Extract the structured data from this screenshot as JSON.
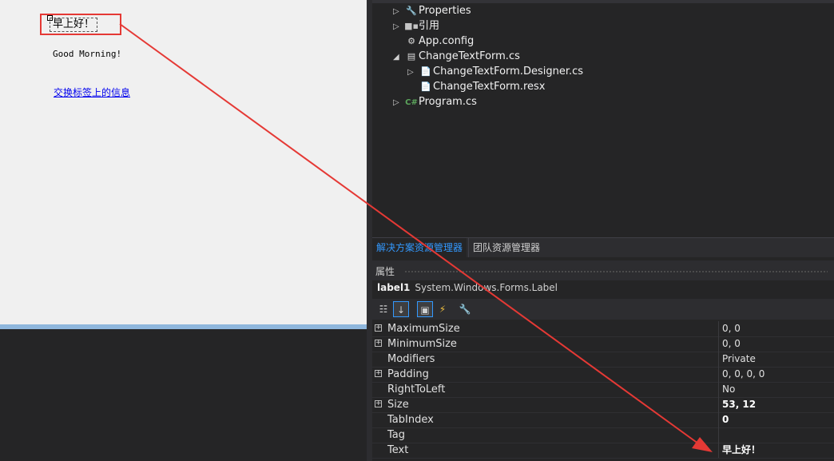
{
  "designer": {
    "label1_text": "早上好！",
    "label2_text": "Good Morning!",
    "link_text": "交换标签上的信息"
  },
  "solution_tree": {
    "items": [
      {
        "label": "Properties",
        "icon": "wrench-icon",
        "expander": "▷"
      },
      {
        "label": "引用",
        "icon": "references-icon",
        "expander": "▷"
      },
      {
        "label": "App.config",
        "icon": "config-file-icon",
        "expander": ""
      },
      {
        "label": "ChangeTextForm.cs",
        "icon": "form-icon",
        "expander": "◢"
      },
      {
        "label": "ChangeTextForm.Designer.cs",
        "icon": "cs-file-icon",
        "expander": "▷"
      },
      {
        "label": "ChangeTextForm.resx",
        "icon": "resx-file-icon",
        "expander": ""
      },
      {
        "label": "Program.cs",
        "icon": "csharp-icon",
        "expander": "▷"
      }
    ]
  },
  "tabs": {
    "solution_explorer": "解决方案资源管理器",
    "team_explorer": "团队资源管理器"
  },
  "properties": {
    "title": "属性",
    "object_name": "label1",
    "object_type": "System.Windows.Forms.Label",
    "rows": [
      {
        "name": "MaximumSize",
        "value": "0, 0",
        "expandable": true,
        "bold": false
      },
      {
        "name": "MinimumSize",
        "value": "0, 0",
        "expandable": true,
        "bold": false
      },
      {
        "name": "Modifiers",
        "value": "Private",
        "expandable": false,
        "bold": false
      },
      {
        "name": "Padding",
        "value": "0, 0, 0, 0",
        "expandable": true,
        "bold": false
      },
      {
        "name": "RightToLeft",
        "value": "No",
        "expandable": false,
        "bold": false
      },
      {
        "name": "Size",
        "value": "53, 12",
        "expandable": true,
        "bold": true
      },
      {
        "name": "TabIndex",
        "value": "0",
        "expandable": false,
        "bold": true
      },
      {
        "name": "Tag",
        "value": "",
        "expandable": false,
        "bold": false
      },
      {
        "name": "Text",
        "value": "早上好！",
        "expandable": false,
        "bold": true
      }
    ]
  },
  "colors": {
    "annotation": "#e53935",
    "accent": "#3399ff"
  }
}
